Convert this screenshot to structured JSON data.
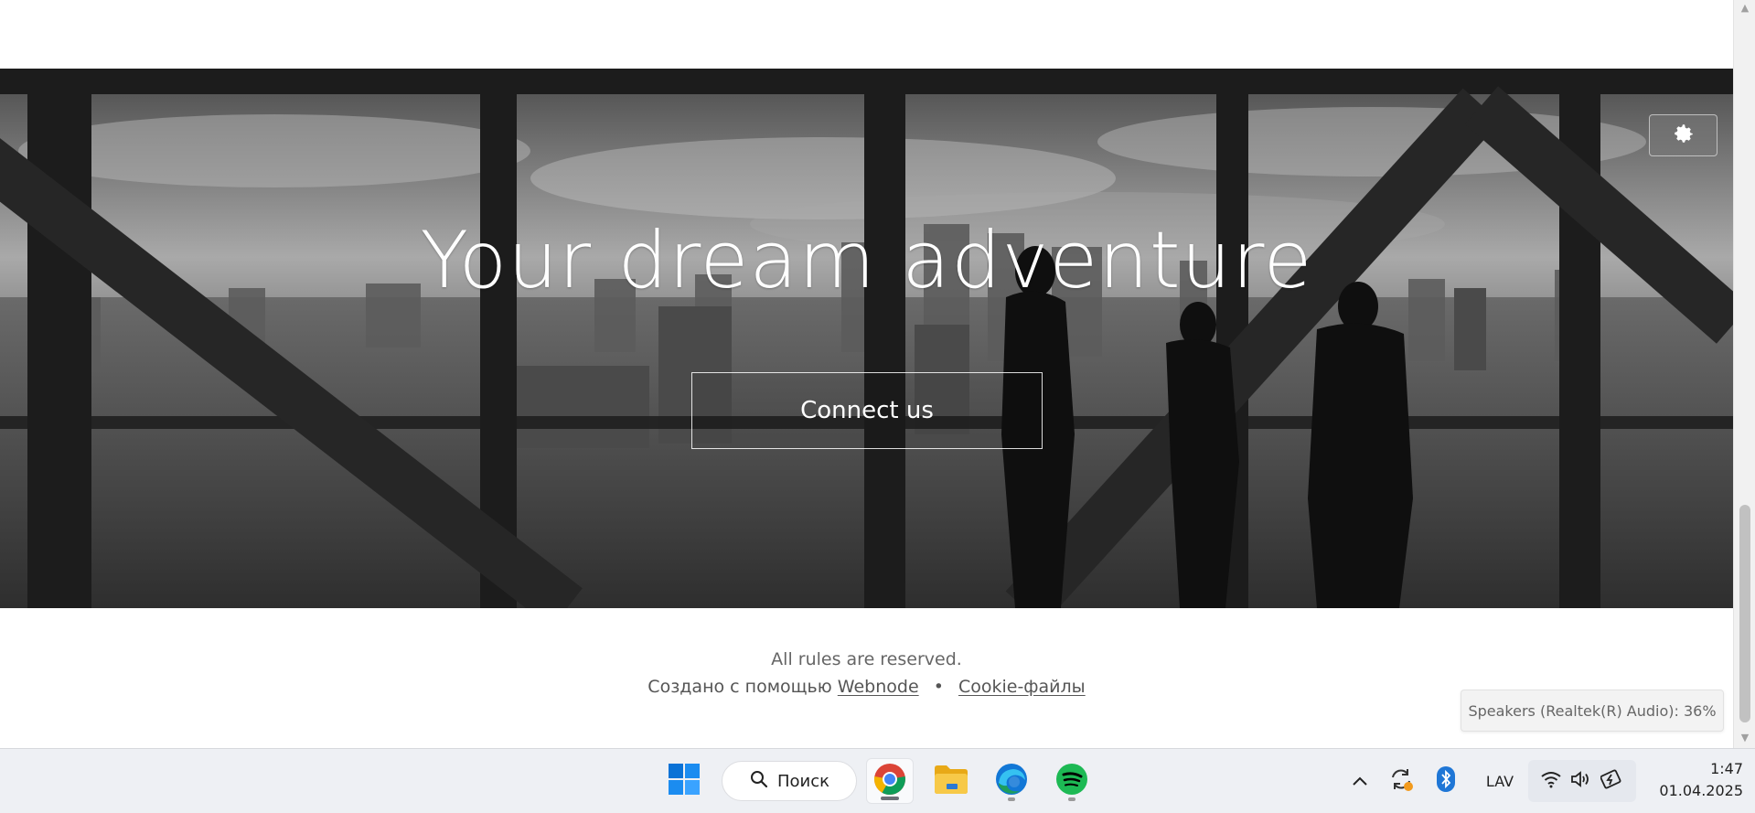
{
  "hero": {
    "title": "Your dream adventure",
    "cta_label": "Connect us"
  },
  "footer": {
    "rules": "All rules are reserved.",
    "created_with": "Создано с помощью",
    "webnode_link": "Webnode",
    "separator": "•",
    "cookie_link": "Cookie-файлы"
  },
  "volume_tooltip": "Speakers (Realtek(R) Audio): 36%",
  "taskbar": {
    "search_label": "Поиск",
    "language": "LAV",
    "time": "1:47",
    "date": "01.04.2025",
    "apps": [
      {
        "name": "chrome-icon",
        "state": "active"
      },
      {
        "name": "file-explorer-icon",
        "state": "none"
      },
      {
        "name": "edge-icon",
        "state": "open"
      },
      {
        "name": "spotify-icon",
        "state": "open"
      }
    ]
  },
  "colors": {
    "windows_blue": "#0078d4",
    "spotify_green": "#1db954",
    "explorer_yellow": "#f4c542",
    "bluetooth_blue": "#1e76d6"
  }
}
